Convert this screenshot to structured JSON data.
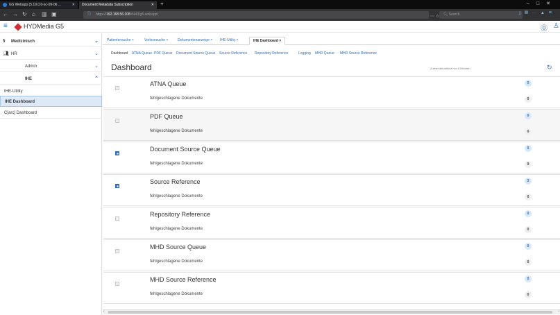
{
  "browser": {
    "tabs": [
      {
        "label": "GS Webapp (5.19.0.0-sc-09-06 ..."
      },
      {
        "label": "Document Metadata Subscription"
      }
    ],
    "url_host": "192.168.56.108",
    "url_rest": ":8443/g5-webapp/",
    "url_prefix": "https://",
    "search_placeholder": "Search"
  },
  "app": {
    "brand": "HYDMedia G5",
    "accent_color": "#2b6cb8",
    "logo_color": "#d32f2f"
  },
  "sidebar": {
    "items": [
      {
        "label": "Medizinisch"
      },
      {
        "label": "HR"
      },
      {
        "label": "Admin"
      },
      {
        "label": "IHE"
      },
      {
        "label": "IHE-Utility"
      },
      {
        "label": "IHE Dashboard"
      },
      {
        "label": "C[arc] Dashboard"
      }
    ]
  },
  "tabs": [
    {
      "label": "Patientensuche ×"
    },
    {
      "label": "Vorlesesuche ×"
    },
    {
      "label": "Dokumentenanzeige ×"
    },
    {
      "label": "IHE-Utility ×"
    },
    {
      "label": "IHE Dashboard ×"
    }
  ],
  "subnav": [
    {
      "label": "Dashboard"
    },
    {
      "label": "ATNA Queue"
    },
    {
      "label": "PDF Queue"
    },
    {
      "label": "Document Source Queue"
    },
    {
      "label": "Source Reference"
    },
    {
      "label": "Repository Reference"
    },
    {
      "label": "Logging"
    },
    {
      "label": "MHD Queue"
    },
    {
      "label": "MHD Source Reference"
    }
  ],
  "page": {
    "title": "Dashboard",
    "updated": "Zuletzt aktualisiert vor 0 Minuten"
  },
  "cards": [
    {
      "title": "ATNA Queue",
      "subtitle": "fehlgeschlagene Dokumente",
      "count": "0",
      "failed": "0"
    },
    {
      "title": "PDF Queue",
      "subtitle": "fehlgeschlagene Dokumente",
      "count": "0",
      "failed": "0"
    },
    {
      "title": "Document Source Queue",
      "subtitle": "fehlgeschlagene Dokumente",
      "count": "9",
      "failed": "9"
    },
    {
      "title": "Source Reference",
      "subtitle": "fehlgeschlagene Dokumente",
      "count": "3",
      "failed": "0"
    },
    {
      "title": "Repository Reference",
      "subtitle": "fehlgeschlagene Dokumente",
      "count": "0",
      "failed": "0"
    },
    {
      "title": "MHD Source Queue",
      "subtitle": "fehlgeschlagene Dokumente",
      "count": "0",
      "failed": "0"
    },
    {
      "title": "MHD Source Reference",
      "subtitle": "fehlgeschlagene Dokumente",
      "count": "0",
      "failed": "0"
    }
  ]
}
